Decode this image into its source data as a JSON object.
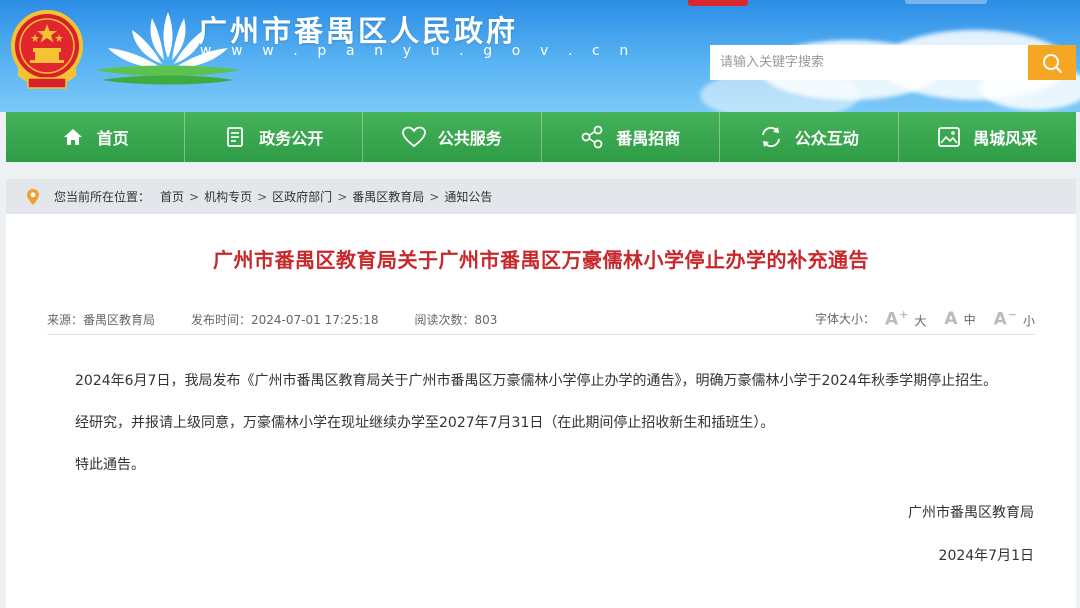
{
  "header": {
    "site_title": "广州市番禺区人民政府",
    "site_url": "w w w . p a n y u . g o v . c n",
    "search_placeholder": "请输入关键字搜索",
    "colors": {
      "brand_blue": "#2c8de6",
      "search_orange": "#f5a623"
    }
  },
  "nav": {
    "items": [
      {
        "label": "首页",
        "icon": "home-icon"
      },
      {
        "label": "政务公开",
        "icon": "document-icon"
      },
      {
        "label": "公共服务",
        "icon": "heart-icon"
      },
      {
        "label": "番禺招商",
        "icon": "share-nodes-icon"
      },
      {
        "label": "公众互动",
        "icon": "refresh-icon"
      },
      {
        "label": "禺城风采",
        "icon": "image-icon"
      }
    ],
    "color": "#3aa74f"
  },
  "breadcrumb": {
    "prefix": "您当前所在位置：",
    "items": [
      "首页",
      "机构专页",
      "区政府部门",
      "番禺区教育局",
      "通知公告"
    ],
    "separator": ">"
  },
  "article": {
    "title": "广州市番禺区教育局关于广州市番禺区万豪儒林小学停止办学的补充通告",
    "title_color": "#c8282c",
    "meta": {
      "source": "来源：番禺区教育局",
      "publish_time": "发布时间：2024-07-01 17:25:18",
      "views": "阅读次数：803"
    },
    "font_size": {
      "label": "字体大小：",
      "large": "大",
      "medium": "中",
      "small": "小"
    },
    "paragraphs": [
      "2024年6月7日，我局发布《广州市番禺区教育局关于广州市番禺区万豪儒林小学停止办学的通告》，明确万豪儒林小学于2024年秋季学期停止招生。",
      "经研究，并报请上级同意，万豪儒林小学在现址继续办学至2027年7月31日（在此期间停止招收新生和插班生）。",
      "特此通告。"
    ],
    "signature": "广州市番禺区教育局",
    "date": "2024年7月1日"
  }
}
